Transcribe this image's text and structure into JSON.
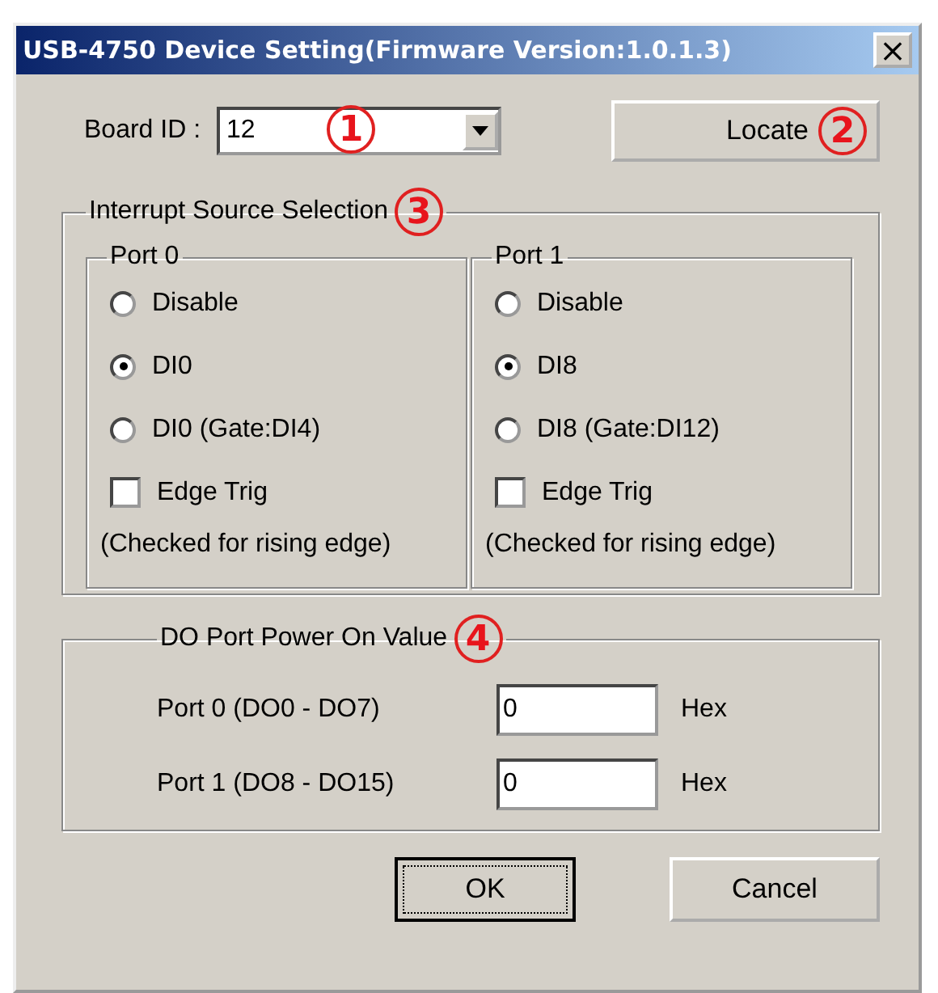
{
  "window": {
    "title": "USB-4750 Device Setting(Firmware Version:1.0.1.3)",
    "close": "×"
  },
  "board_id": {
    "label": "Board ID :",
    "value": "12",
    "callout": "1"
  },
  "locate_button": {
    "label": "Locate",
    "callout": "2"
  },
  "interrupt_group": {
    "title": "Interrupt Source Selection",
    "callout": "3",
    "ports": [
      {
        "title": "Port 0",
        "options": [
          {
            "label": "Disable",
            "selected": false
          },
          {
            "label": "DI0",
            "selected": true
          },
          {
            "label": "DI0 (Gate:DI4)",
            "selected": false
          }
        ],
        "edge_trig": {
          "label": "Edge Trig",
          "checked": false
        },
        "note": "(Checked for rising edge)"
      },
      {
        "title": "Port 1",
        "options": [
          {
            "label": "Disable",
            "selected": false
          },
          {
            "label": "DI8",
            "selected": true
          },
          {
            "label": "DI8 (Gate:DI12)",
            "selected": false
          }
        ],
        "edge_trig": {
          "label": "Edge Trig",
          "checked": false
        },
        "note": "(Checked for rising edge)"
      }
    ]
  },
  "do_group": {
    "title": "DO Port Power On Value",
    "callout": "4",
    "rows": [
      {
        "label": "Port 0 (DO0 - DO7)",
        "value": "0",
        "unit": "Hex"
      },
      {
        "label": "Port 1 (DO8 - DO15)",
        "value": "0",
        "unit": "Hex"
      }
    ]
  },
  "buttons": [
    {
      "label": "OK",
      "focused": true
    },
    {
      "label": "Cancel",
      "focused": false
    }
  ]
}
